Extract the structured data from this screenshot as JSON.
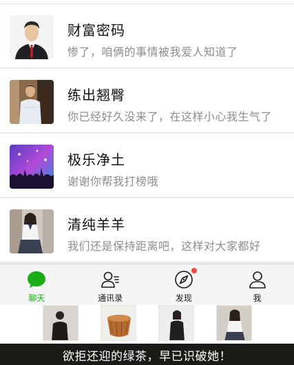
{
  "chats": [
    {
      "name": "财富密码",
      "message": "惨了，咱俩的事情被我爱人知道了",
      "avatar_icon": "businessman-avatar"
    },
    {
      "name": "练出翘臀",
      "message": "你已经好久没来了，在这样小心我生气了",
      "avatar_icon": "man-photo-avatar"
    },
    {
      "name": "极乐净土",
      "message": "谢谢你帮我打榜哦",
      "avatar_icon": "concert-crowd-avatar"
    },
    {
      "name": "清纯羊羊",
      "message": "我们还是保持距离吧，这样对大家都好",
      "avatar_icon": "schoolgirl-avatar"
    }
  ],
  "tabbar": {
    "tabs": [
      {
        "label": "聊天",
        "icon": "chat-bubble-icon",
        "active": true
      },
      {
        "label": "通讯录",
        "icon": "contacts-icon",
        "active": false
      },
      {
        "label": "发现",
        "icon": "compass-icon",
        "active": false,
        "badge": "red-dot"
      },
      {
        "label": "我",
        "icon": "person-icon",
        "active": false
      }
    ]
  },
  "caption": "欲拒还迎的绿茶，早已识破她！",
  "colors": {
    "active_green": "#1aad19",
    "badge_red": "#f04b40",
    "name_text": "#111111",
    "message_text": "#8d8d8d"
  }
}
